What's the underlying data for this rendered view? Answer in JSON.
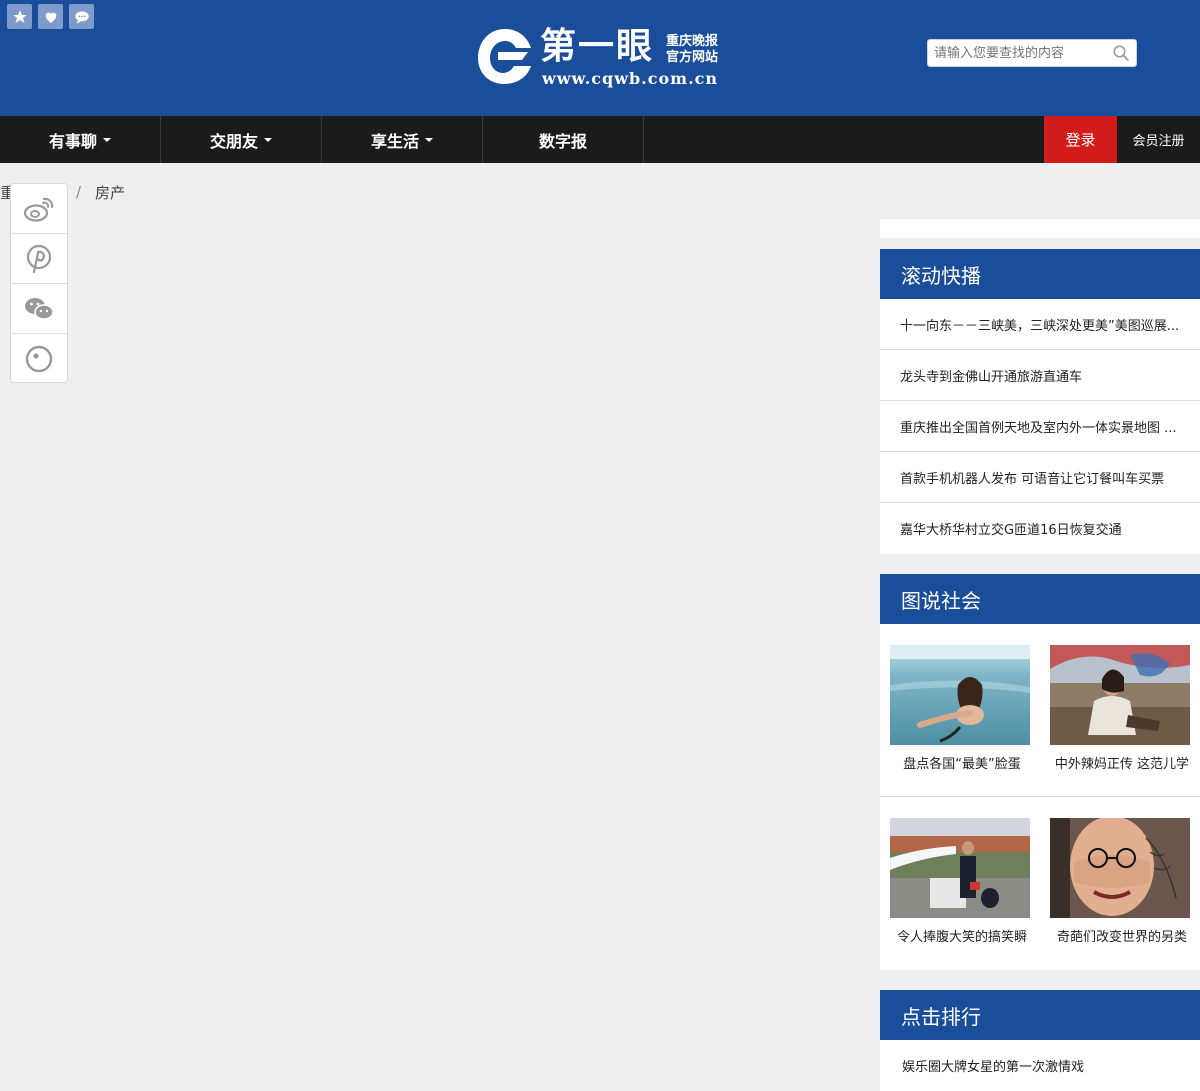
{
  "header": {
    "top_icons": [
      "star-icon",
      "heart-icon",
      "chat-icon"
    ],
    "logo": {
      "main": "第一眼",
      "sub_line1": "重庆晚报",
      "sub_line2": "官方网站",
      "url": "www.cqwb.com.cn"
    },
    "search": {
      "placeholder": "请输入您要查找的内容"
    }
  },
  "nav": {
    "items": [
      {
        "label": "有事聊",
        "dropdown": true
      },
      {
        "label": "交朋友",
        "dropdown": true
      },
      {
        "label": "享生活",
        "dropdown": true
      },
      {
        "label": "数字报",
        "dropdown": false
      }
    ],
    "login": "登录",
    "register": "会员注册"
  },
  "breadcrumb": {
    "home": "重",
    "separator": "/",
    "current": "房产"
  },
  "share": [
    "weibo-icon",
    "pinterest-icon",
    "wechat-icon",
    "circle-icon"
  ],
  "sidebar": {
    "scroll_news": {
      "title": "滚动快播",
      "items": [
        "十一向东－－三峡美，三峡深处更美”美图巡展...",
        "龙头寺到金佛山开通旅游直通车",
        "重庆推出全国首例天地及室内外一体实景地图 ...",
        "首款手机机器人发布 可语音让它订餐叫车买票",
        "嘉华大桥华村立交G匝道16日恢复交通"
      ]
    },
    "photo_society": {
      "title": "图说社会",
      "items": [
        {
          "caption": "盘点各国“最美”脸蛋"
        },
        {
          "caption": "中外辣妈正传 这范儿学"
        },
        {
          "caption": "令人捧腹大笑的搞笑瞬"
        },
        {
          "caption": "奇葩们改变世界的另类"
        }
      ]
    },
    "ranking": {
      "title": "点击排行",
      "items": [
        "娱乐圈大牌女星的第一次激情戏"
      ]
    }
  },
  "colors": {
    "brand_blue": "#1a4e9a",
    "nav_black": "#1b1b1b",
    "login_red": "#d21c1c"
  }
}
